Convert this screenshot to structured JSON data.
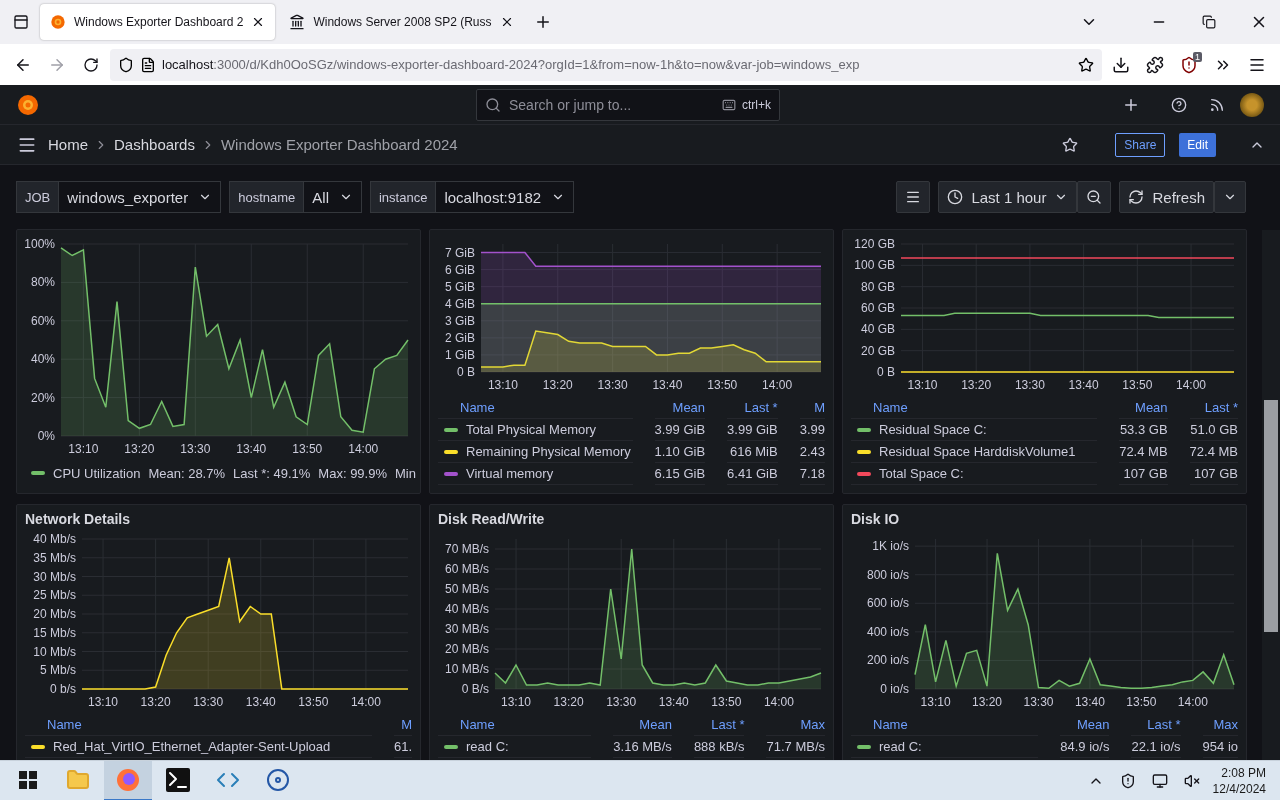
{
  "browser": {
    "tabs": [
      {
        "title": "Windows Exporter Dashboard 2",
        "kind": "grafana",
        "selected": true
      },
      {
        "title": "Windows Server 2008 SP2 (Russ",
        "kind": "site",
        "selected": false
      }
    ],
    "url": {
      "host": "localhost",
      "path": ":3000/d/Kdh0OoSGz/windows-exporter-dashboard-2024?orgId=1&from=now-1h&to=now&var-job=windows_exp"
    },
    "extension_badge": "1"
  },
  "topbar": {
    "search": {
      "placeholder": "Search or jump to...",
      "shortcut": "ctrl+k"
    }
  },
  "breadcrumbs": [
    "Home",
    "Dashboards",
    "Windows Exporter Dashboard 2024"
  ],
  "actions": {
    "share": "Share",
    "edit": "Edit"
  },
  "variables": [
    {
      "label": "JOB",
      "value": "windows_exporter"
    },
    {
      "label": "hostname",
      "value": "All"
    },
    {
      "label": "instance",
      "value": "localhost:9182"
    }
  ],
  "time_range": "Last 1 hour",
  "refresh": "Refresh",
  "panels": [
    {
      "chart_data": {
        "type": "area",
        "categories": [
          null,
          null,
          "13:10",
          null,
          null,
          null,
          null,
          "13:20",
          null,
          null,
          null,
          null,
          "13:30",
          null,
          null,
          null,
          null,
          "13:40",
          null,
          null,
          null,
          null,
          "13:50",
          null,
          null,
          null,
          null,
          "14:00",
          null,
          null,
          null,
          null
        ],
        "ylim": [
          0,
          100
        ],
        "grid": true,
        "yticks": [
          {
            "value": 0,
            "label": "0%"
          },
          {
            "value": 20,
            "label": "20%"
          },
          {
            "value": 40,
            "label": "40%"
          },
          {
            "value": 60,
            "label": "60%"
          },
          {
            "value": 80,
            "label": "80%"
          },
          {
            "value": 100,
            "label": "100%"
          }
        ],
        "series": [
          {
            "name": "CPU Utilization",
            "color": "#73bf69",
            "values": [
              98,
              94,
              97,
              30,
              15,
              70,
              8,
              4,
              6,
              18,
              5,
              6,
              88,
              52,
              58,
              35,
              50,
              20,
              45,
              15,
              28,
              10,
              6,
              42,
              48,
              10,
              3,
              2,
              35,
              40,
              42,
              50
            ]
          }
        ]
      },
      "legend": {
        "kind": "list",
        "rows": [
          {
            "values": [
              "Mean: 28.7%",
              "Last *: 49.1%",
              "Max: 99.9%",
              "Min"
            ]
          }
        ]
      }
    },
    {
      "chart_data": {
        "type": "area",
        "categories": [
          null,
          null,
          "13:10",
          null,
          null,
          null,
          null,
          "13:20",
          null,
          null,
          null,
          null,
          "13:30",
          null,
          null,
          null,
          null,
          "13:40",
          null,
          null,
          null,
          null,
          "13:50",
          null,
          null,
          null,
          null,
          "14:00",
          null,
          null,
          null,
          null
        ],
        "ylim": [
          0,
          7.5
        ],
        "grid": true,
        "yticks": [
          {
            "value": 0,
            "label": "0 B"
          },
          {
            "value": 1,
            "label": "1 GiB"
          },
          {
            "value": 2,
            "label": "2 GiB"
          },
          {
            "value": 3,
            "label": "3 GiB"
          },
          {
            "value": 4,
            "label": "4 GiB"
          },
          {
            "value": 5,
            "label": "5 GiB"
          },
          {
            "value": 6,
            "label": "6 GiB"
          },
          {
            "value": 7,
            "label": "7 GiB"
          }
        ],
        "series": [
          {
            "name": "Total Physical Memory",
            "color": "#73bf69",
            "values": [
              4,
              4,
              4,
              4,
              4,
              4,
              4,
              4,
              4,
              4,
              4,
              4,
              4,
              4,
              4,
              4,
              4,
              4,
              4,
              4,
              4,
              4,
              4,
              4,
              4,
              4,
              4,
              4,
              4,
              4,
              4,
              4
            ]
          },
          {
            "name": "Remaining Physical Memory",
            "color": "#fade2a",
            "values": [
              0.3,
              0.3,
              0.3,
              0.4,
              0.4,
              2.4,
              2.3,
              2.2,
              1.8,
              1.7,
              1.7,
              1.7,
              1.5,
              1.5,
              1.5,
              1.5,
              1.0,
              1.0,
              1.1,
              1.1,
              1.4,
              1.4,
              1.5,
              1.6,
              1.3,
              1.1,
              0.6,
              0.6,
              0.6,
              0.6,
              0.6,
              0.6
            ]
          },
          {
            "name": "Virtual memory",
            "color": "#a352cc",
            "values": [
              7,
              7,
              7,
              7,
              7,
              6.2,
              6.2,
              6.2,
              6.2,
              6.2,
              6.2,
              6.2,
              6.2,
              6.2,
              6.2,
              6.2,
              6.2,
              6.2,
              6.2,
              6.2,
              6.2,
              6.2,
              6.2,
              6.2,
              6.2,
              6.2,
              6.2,
              6.2,
              6.2,
              6.2,
              6.2,
              6.2
            ]
          }
        ]
      },
      "legend": {
        "kind": "table",
        "columns": [
          "Name",
          "Mean",
          "Last *",
          "M"
        ],
        "rows": [
          {
            "values": [
              "3.99 GiB",
              "3.99 GiB",
              "3.99"
            ]
          },
          {
            "values": [
              "1.10 GiB",
              "616 MiB",
              "2.43"
            ]
          },
          {
            "values": [
              "6.15 GiB",
              "6.41 GiB",
              "7.18"
            ]
          }
        ]
      }
    },
    {
      "chart_data": {
        "type": "line",
        "categories": [
          null,
          null,
          "13:10",
          null,
          null,
          null,
          null,
          "13:20",
          null,
          null,
          null,
          null,
          "13:30",
          null,
          null,
          null,
          null,
          "13:40",
          null,
          null,
          null,
          null,
          "13:50",
          null,
          null,
          null,
          null,
          "14:00",
          null,
          null,
          null,
          null
        ],
        "ylim": [
          0,
          120
        ],
        "grid": true,
        "yticks": [
          {
            "value": 0,
            "label": "0 B"
          },
          {
            "value": 20,
            "label": "20 GB"
          },
          {
            "value": 40,
            "label": "40 GB"
          },
          {
            "value": 60,
            "label": "60 GB"
          },
          {
            "value": 80,
            "label": "80 GB"
          },
          {
            "value": 100,
            "label": "100 GB"
          },
          {
            "value": 120,
            "label": "120 GB"
          }
        ],
        "series": [
          {
            "name": "Residual Space C:",
            "color": "#73bf69",
            "values": [
              53,
              53,
              53,
              53,
              53,
              55,
              55,
              55,
              55,
              55,
              55,
              55,
              55,
              53,
              53,
              53,
              53,
              53,
              53,
              53,
              53,
              53,
              53,
              53,
              51,
              51,
              51,
              51,
              51,
              51,
              51,
              51
            ]
          },
          {
            "name": "Residual Space HarddiskVolume1",
            "color": "#fade2a",
            "values": [
              0,
              0,
              0,
              0,
              0,
              0,
              0,
              0,
              0,
              0,
              0,
              0,
              0,
              0,
              0,
              0,
              0,
              0,
              0,
              0,
              0,
              0,
              0,
              0,
              0,
              0,
              0,
              0,
              0,
              0,
              0,
              0
            ]
          },
          {
            "name": "Total Space C:",
            "color": "#f2495c",
            "values": [
              107,
              107,
              107,
              107,
              107,
              107,
              107,
              107,
              107,
              107,
              107,
              107,
              107,
              107,
              107,
              107,
              107,
              107,
              107,
              107,
              107,
              107,
              107,
              107,
              107,
              107,
              107,
              107,
              107,
              107,
              107,
              107
            ]
          }
        ]
      },
      "legend": {
        "kind": "table",
        "columns": [
          "Name",
          "Mean",
          "Last *"
        ],
        "rows": [
          {
            "values": [
              "53.3 GB",
              "51.0 GB"
            ]
          },
          {
            "values": [
              "72.4 MB",
              "72.4 MB"
            ]
          },
          {
            "values": [
              "107 GB",
              "107 GB"
            ]
          }
        ]
      }
    },
    {
      "title": "Network Details",
      "chart_data": {
        "type": "area",
        "categories": [
          null,
          null,
          "13:10",
          null,
          null,
          null,
          null,
          "13:20",
          null,
          null,
          null,
          null,
          "13:30",
          null,
          null,
          null,
          null,
          "13:40",
          null,
          null,
          null,
          null,
          "13:50",
          null,
          null,
          null,
          null,
          "14:00",
          null,
          null,
          null,
          null
        ],
        "ylim": [
          0,
          40
        ],
        "grid": true,
        "yticks": [
          {
            "value": 0,
            "label": "0 b/s"
          },
          {
            "value": 5,
            "label": "5 Mb/s"
          },
          {
            "value": 10,
            "label": "10 Mb/s"
          },
          {
            "value": 15,
            "label": "15 Mb/s"
          },
          {
            "value": 20,
            "label": "20 Mb/s"
          },
          {
            "value": 25,
            "label": "25 Mb/s"
          },
          {
            "value": 30,
            "label": "30 Mb/s"
          },
          {
            "value": 35,
            "label": "35 Mb/s"
          },
          {
            "value": 40,
            "label": "40 Mb/s"
          }
        ],
        "series": [
          {
            "name": "Red_Hat_VirtIO_Ethernet_Adapter-Sent-Upload",
            "color": "#fade2a",
            "values": [
              0,
              0,
              0,
              0,
              0,
              0,
              0,
              0.5,
              9,
              15,
              19,
              20,
              21,
              22,
              35,
              18,
              22,
              20,
              20,
              0,
              0,
              0,
              0,
              0,
              0,
              0,
              0,
              0,
              0,
              0,
              0,
              0
            ]
          }
        ]
      },
      "legend": {
        "kind": "table",
        "columns": [
          "Name",
          "M"
        ],
        "rows": [
          {
            "values": [
              "61."
            ]
          }
        ]
      }
    },
    {
      "title": "Disk Read/Write",
      "chart_data": {
        "type": "area",
        "categories": [
          null,
          null,
          "13:10",
          null,
          null,
          null,
          null,
          "13:20",
          null,
          null,
          null,
          null,
          "13:30",
          null,
          null,
          null,
          null,
          "13:40",
          null,
          null,
          null,
          null,
          "13:50",
          null,
          null,
          null,
          null,
          "14:00",
          null,
          null,
          null,
          null
        ],
        "ylim": [
          0,
          75
        ],
        "grid": true,
        "yticks": [
          {
            "value": 0,
            "label": "0 B/s"
          },
          {
            "value": 10,
            "label": "10 MB/s"
          },
          {
            "value": 20,
            "label": "20 MB/s"
          },
          {
            "value": 30,
            "label": "30 MB/s"
          },
          {
            "value": 40,
            "label": "40 MB/s"
          },
          {
            "value": 50,
            "label": "50 MB/s"
          },
          {
            "value": 60,
            "label": "60 MB/s"
          },
          {
            "value": 70,
            "label": "70 MB/s"
          }
        ],
        "series": [
          {
            "name": "read C:",
            "color": "#73bf69",
            "values": [
              8,
              3,
              12,
              2,
              2,
              3,
              2,
              2,
              2,
              3,
              2,
              50,
              15,
              70,
              12,
              3,
              2,
              2,
              3,
              2,
              3,
              12,
              4,
              3,
              2,
              2,
              3,
              3,
              4,
              5,
              6,
              8
            ]
          }
        ]
      },
      "legend": {
        "kind": "table",
        "columns": [
          "Name",
          "Mean",
          "Last *",
          "Max"
        ],
        "rows": [
          {
            "values": [
              "3.16 MB/s",
              "888 kB/s",
              "71.7 MB/s"
            ]
          }
        ]
      }
    },
    {
      "title": "Disk IO",
      "chart_data": {
        "type": "area",
        "categories": [
          null,
          null,
          "13:10",
          null,
          null,
          null,
          null,
          "13:20",
          null,
          null,
          null,
          null,
          "13:30",
          null,
          null,
          null,
          null,
          "13:40",
          null,
          null,
          null,
          null,
          "13:50",
          null,
          null,
          null,
          null,
          "14:00",
          null,
          null,
          null,
          null
        ],
        "ylim": [
          0,
          1050
        ],
        "grid": true,
        "yticks": [
          {
            "value": 0,
            "label": "0 io/s"
          },
          {
            "value": 200,
            "label": "200 io/s"
          },
          {
            "value": 400,
            "label": "400 io/s"
          },
          {
            "value": 600,
            "label": "600 io/s"
          },
          {
            "value": 800,
            "label": "800 io/s"
          },
          {
            "value": 1000,
            "label": "1K io/s"
          }
        ],
        "series": [
          {
            "name": "read C:",
            "color": "#73bf69",
            "values": [
              100,
              450,
              50,
              340,
              20,
              250,
              270,
              20,
              950,
              550,
              700,
              450,
              10,
              5,
              60,
              20,
              40,
              210,
              30,
              20,
              10,
              5,
              5,
              10,
              20,
              30,
              50,
              60,
              120,
              40,
              240,
              30
            ]
          }
        ]
      },
      "legend": {
        "kind": "table",
        "columns": [
          "Name",
          "Mean",
          "Last *",
          "Max"
        ],
        "rows": [
          {
            "values": [
              "84.9 io/s",
              "22.1 io/s",
              "954 io"
            ]
          }
        ]
      }
    }
  ],
  "taskbar": {
    "apps": [
      {
        "kind": "explorer",
        "selected": false
      },
      {
        "kind": "firefox",
        "selected": true
      },
      {
        "kind": "terminal",
        "selected": false
      },
      {
        "kind": "editor",
        "selected": false
      },
      {
        "kind": "installer",
        "selected": false
      }
    ],
    "time": "2:08 PM",
    "date": "12/4/2024"
  }
}
